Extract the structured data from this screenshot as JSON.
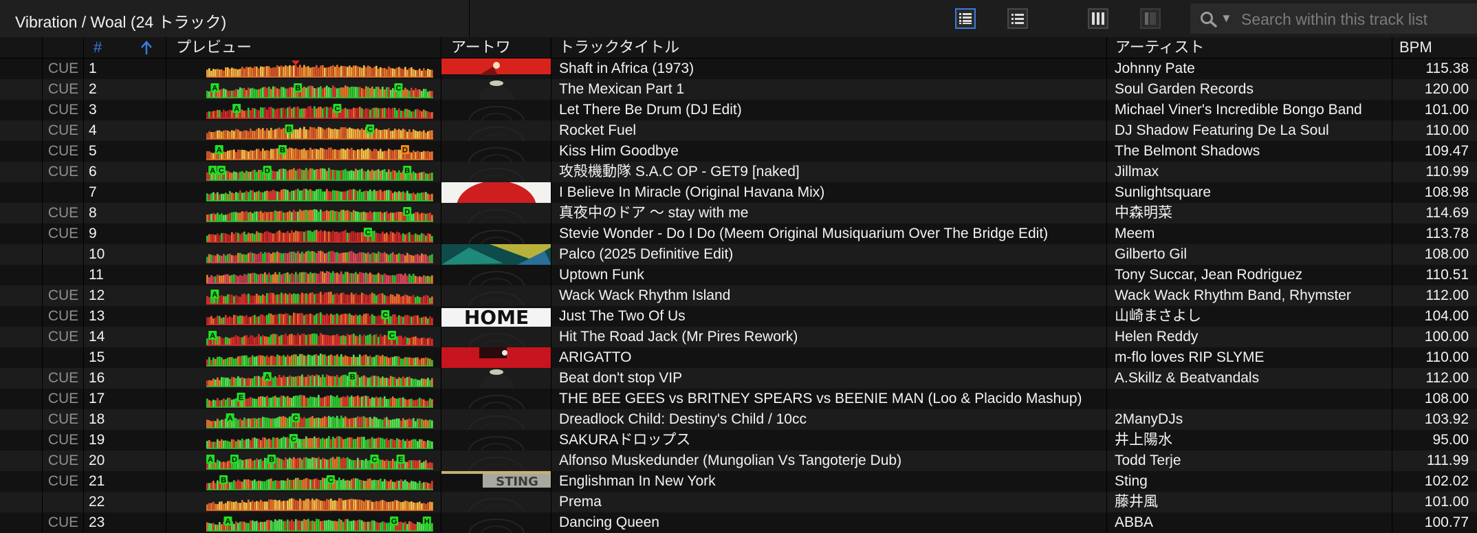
{
  "playlist_title": "Vibration / Woal (24 トラック)",
  "view_buttons": [
    {
      "icon": "list-detail-icon",
      "active": true
    },
    {
      "icon": "list-simple-icon",
      "active": false
    },
    {
      "icon": "column-browser-icon",
      "active": false
    },
    {
      "icon": "split-panel-icon",
      "active": false
    }
  ],
  "search": {
    "placeholder": "Search within this track list",
    "value": ""
  },
  "columns": {
    "cue": "",
    "num": "#",
    "preview": "プレビュー",
    "artwork": "アートワ",
    "title": "トラックタイトル",
    "artist": "アーティスト",
    "bpm": "BPM"
  },
  "sort": {
    "column": "num",
    "direction": "ascending"
  },
  "colors": {
    "accent": "#3a7be0",
    "cue_marker": "#22dd22",
    "waveform_warm": "#e8752a",
    "waveform_red": "#d92e2e",
    "waveform_green": "#30c830"
  },
  "tracks": [
    {
      "cue": "CUE",
      "num": "1",
      "title": "Shaft in Africa  (1973)",
      "artist": "Johnny Pate",
      "bpm": "115.38",
      "art": "red-sun",
      "wave": "orange",
      "markers": [
        {
          "l": "",
          "p": 0.39,
          "red": true
        }
      ]
    },
    {
      "cue": "CUE",
      "num": "2",
      "title": "The Mexican Part 1",
      "artist": "Soul Garden Records",
      "bpm": "120.00",
      "art": "dark-disc",
      "wave": "green",
      "markers": [
        {
          "l": "A",
          "p": 0.02
        },
        {
          "l": "B",
          "p": 0.4
        },
        {
          "l": "C",
          "p": 0.86
        }
      ]
    },
    {
      "cue": "CUE",
      "num": "3",
      "title": "Let There Be Drum (DJ Edit)",
      "artist": "Michael Viner's Incredible Bongo Band",
      "bpm": "101.00",
      "art": "none",
      "wave": "red",
      "markers": [
        {
          "l": "A",
          "p": 0.12
        },
        {
          "l": "C",
          "p": 0.58
        }
      ]
    },
    {
      "cue": "CUE",
      "num": "4",
      "title": "Rocket Fuel",
      "artist": "DJ Shadow Featuring De La Soul",
      "bpm": "110.00",
      "art": "none",
      "wave": "orange",
      "markers": [
        {
          "l": "B",
          "p": 0.36
        },
        {
          "l": "C",
          "p": 0.73
        }
      ]
    },
    {
      "cue": "CUE",
      "num": "5",
      "title": "Kiss Him Goodbye",
      "artist": "The Belmont Shadows",
      "bpm": "109.47",
      "art": "none",
      "wave": "orange",
      "markers": [
        {
          "l": "A",
          "p": 0.04
        },
        {
          "l": "B",
          "p": 0.33
        },
        {
          "l": "D",
          "p": 0.89,
          "orange": true
        }
      ]
    },
    {
      "cue": "CUE",
      "num": "6",
      "title": "攻殻機動隊 S.A.C OP - GET9 [naked]",
      "artist": "Jillmax",
      "bpm": "110.99",
      "art": "none",
      "wave": "green",
      "markers": [
        {
          "l": "A",
          "p": 0.01
        },
        {
          "l": "C",
          "p": 0.05
        },
        {
          "l": "D",
          "p": 0.26
        },
        {
          "l": "B",
          "p": 0.9
        }
      ]
    },
    {
      "cue": "",
      "num": "7",
      "title": "I Believe In Miracle (Original Havana Mix)",
      "artist": "Sunlightsquare",
      "bpm": "108.98",
      "art": "red-disc",
      "wave": "green",
      "markers": []
    },
    {
      "cue": "CUE",
      "num": "8",
      "title": "真夜中のドア 〜 stay with me",
      "artist": "中森明菜",
      "bpm": "114.69",
      "art": "none",
      "wave": "green",
      "markers": [
        {
          "l": "D",
          "p": 0.9
        }
      ]
    },
    {
      "cue": "CUE",
      "num": "9",
      "title": "Stevie Wonder - Do I Do (Meem Original Musiquarium Over The Bridge Edit)",
      "artist": "Meem",
      "bpm": "113.78",
      "art": "none",
      "wave": "red",
      "markers": [
        {
          "l": "C",
          "p": 0.72
        }
      ]
    },
    {
      "cue": "",
      "num": "10",
      "title": "Palco (2025 Definitive Edit)",
      "artist": "Gilberto Gil",
      "bpm": "108.00",
      "art": "teal-leaf",
      "wave": "pink",
      "markers": []
    },
    {
      "cue": "",
      "num": "11",
      "title": "Uptown Funk",
      "artist": "Tony Succar, Jean Rodriguez",
      "bpm": "110.51",
      "art": "none",
      "wave": "pink",
      "markers": []
    },
    {
      "cue": "CUE",
      "num": "12",
      "title": "Wack Wack Rhythm Island",
      "artist": "Wack Wack Rhythm Band, Rhymster",
      "bpm": "112.00",
      "art": "none",
      "wave": "red",
      "markers": [
        {
          "l": "A",
          "p": 0.02
        }
      ]
    },
    {
      "cue": "CUE",
      "num": "13",
      "title": "Just The Two Of Us",
      "artist": "山崎まさよし",
      "bpm": "104.00",
      "art": "home",
      "wave": "red",
      "markers": [
        {
          "l": "C",
          "p": 0.8
        }
      ]
    },
    {
      "cue": "CUE",
      "num": "14",
      "title": "Hit The Road Jack (Mr Pires Rework)",
      "artist": "Helen Reddy",
      "bpm": "100.00",
      "art": "none",
      "wave": "red",
      "markers": [
        {
          "l": "A",
          "p": 0.01
        },
        {
          "l": "C",
          "p": 0.83
        }
      ]
    },
    {
      "cue": "",
      "num": "15",
      "title": "ARIGATTO",
      "artist": "m-flo loves RIP SLYME",
      "bpm": "110.00",
      "art": "red-logo",
      "wave": "green",
      "markers": []
    },
    {
      "cue": "CUE",
      "num": "16",
      "title": "Beat don't stop VIP",
      "artist": "A.Skillz & Beatvandals",
      "bpm": "112.00",
      "art": "dark-disc",
      "wave": "green",
      "markers": [
        {
          "l": "A",
          "p": 0.26
        },
        {
          "l": "B",
          "p": 0.65
        }
      ]
    },
    {
      "cue": "CUE",
      "num": "17",
      "title": "THE BEE GEES vs BRITNEY SPEARS vs BEENIE MAN (Loo & Placido Mashup)",
      "artist": "",
      "bpm": "108.00",
      "art": "none",
      "wave": "green",
      "markers": [
        {
          "l": "E",
          "p": 0.14
        }
      ]
    },
    {
      "cue": "CUE",
      "num": "18",
      "title": "Dreadlock Child: Destiny's Child / 10cc",
      "artist": "2ManyDJs",
      "bpm": "103.92",
      "art": "none",
      "wave": "green",
      "markers": [
        {
          "l": "A",
          "p": 0.09
        },
        {
          "l": "C",
          "p": 0.39
        }
      ]
    },
    {
      "cue": "CUE",
      "num": "19",
      "title": "SAKURAドロップス",
      "artist": "井上陽水",
      "bpm": "95.00",
      "art": "none",
      "wave": "green",
      "markers": [
        {
          "l": "C",
          "p": 0.38
        }
      ]
    },
    {
      "cue": "CUE",
      "num": "20",
      "title": "Alfonso Muskedunder (Mungolian Vs Tangoterje Dub)",
      "artist": "Todd Terje",
      "bpm": "111.99",
      "art": "none",
      "wave": "green",
      "markers": [
        {
          "l": "A",
          "p": 0.0
        },
        {
          "l": "D",
          "p": 0.11
        },
        {
          "l": "B",
          "p": 0.28
        },
        {
          "l": "C",
          "p": 0.75
        },
        {
          "l": "E",
          "p": 0.87
        }
      ]
    },
    {
      "cue": "CUE",
      "num": "21",
      "title": "Englishman In New York",
      "artist": "Sting",
      "bpm": "102.02",
      "art": "sting",
      "wave": "green",
      "markers": [
        {
          "l": "B",
          "p": 0.06
        },
        {
          "l": "C",
          "p": 0.55
        }
      ]
    },
    {
      "cue": "",
      "num": "22",
      "title": "Prema",
      "artist": "藤井風",
      "bpm": "101.00",
      "art": "none",
      "wave": "orange",
      "markers": []
    },
    {
      "cue": "CUE",
      "num": "23",
      "title": "Dancing Queen",
      "artist": "ABBA",
      "bpm": "100.77",
      "art": "none",
      "wave": "green",
      "markers": [
        {
          "l": "A",
          "p": 0.08
        },
        {
          "l": "G",
          "p": 0.84
        },
        {
          "l": "H",
          "p": 0.99
        }
      ]
    }
  ]
}
